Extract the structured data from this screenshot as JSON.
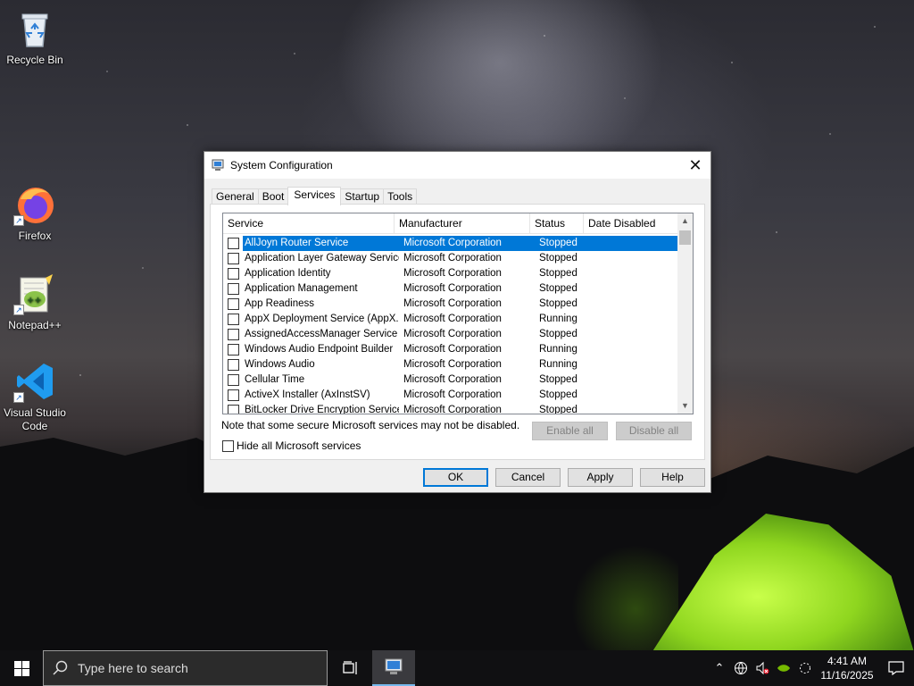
{
  "desktop": {
    "icons": [
      {
        "label": "Recycle Bin"
      },
      {
        "label": "Firefox"
      },
      {
        "label": "Notepad++"
      },
      {
        "label": "Visual Studio Code"
      }
    ]
  },
  "dialog": {
    "title": "System Configuration",
    "tabs": [
      "General",
      "Boot",
      "Services",
      "Startup",
      "Tools"
    ],
    "active_tab": "Services",
    "columns": [
      "Service",
      "Manufacturer",
      "Status",
      "Date Disabled"
    ],
    "rows": [
      {
        "service": "AllJoyn Router Service",
        "manufacturer": "Microsoft Corporation",
        "status": "Stopped",
        "date_disabled": "",
        "selected": true
      },
      {
        "service": "Application Layer Gateway Service",
        "manufacturer": "Microsoft Corporation",
        "status": "Stopped",
        "date_disabled": ""
      },
      {
        "service": "Application Identity",
        "manufacturer": "Microsoft Corporation",
        "status": "Stopped",
        "date_disabled": ""
      },
      {
        "service": "Application Management",
        "manufacturer": "Microsoft Corporation",
        "status": "Stopped",
        "date_disabled": ""
      },
      {
        "service": "App Readiness",
        "manufacturer": "Microsoft Corporation",
        "status": "Stopped",
        "date_disabled": ""
      },
      {
        "service": "AppX Deployment Service (AppX...",
        "manufacturer": "Microsoft Corporation",
        "status": "Running",
        "date_disabled": ""
      },
      {
        "service": "AssignedAccessManager Service",
        "manufacturer": "Microsoft Corporation",
        "status": "Stopped",
        "date_disabled": ""
      },
      {
        "service": "Windows Audio Endpoint Builder",
        "manufacturer": "Microsoft Corporation",
        "status": "Running",
        "date_disabled": ""
      },
      {
        "service": "Windows Audio",
        "manufacturer": "Microsoft Corporation",
        "status": "Running",
        "date_disabled": ""
      },
      {
        "service": "Cellular Time",
        "manufacturer": "Microsoft Corporation",
        "status": "Stopped",
        "date_disabled": ""
      },
      {
        "service": "ActiveX Installer (AxInstSV)",
        "manufacturer": "Microsoft Corporation",
        "status": "Stopped",
        "date_disabled": ""
      },
      {
        "service": "BitLocker Drive Encryption Service",
        "manufacturer": "Microsoft Corporation",
        "status": "Stopped",
        "date_disabled": ""
      }
    ],
    "note": "Note that some secure Microsoft services may not be disabled.",
    "enable_all": "Enable all",
    "disable_all": "Disable all",
    "hide_ms_label": "Hide all Microsoft services",
    "buttons": {
      "ok": "OK",
      "cancel": "Cancel",
      "apply": "Apply",
      "help": "Help"
    }
  },
  "taskbar": {
    "search_placeholder": "Type here to search",
    "time": "4:41 AM",
    "date": "11/16/2025"
  },
  "colors": {
    "accent": "#0078d7",
    "taskbar": "#101012"
  }
}
